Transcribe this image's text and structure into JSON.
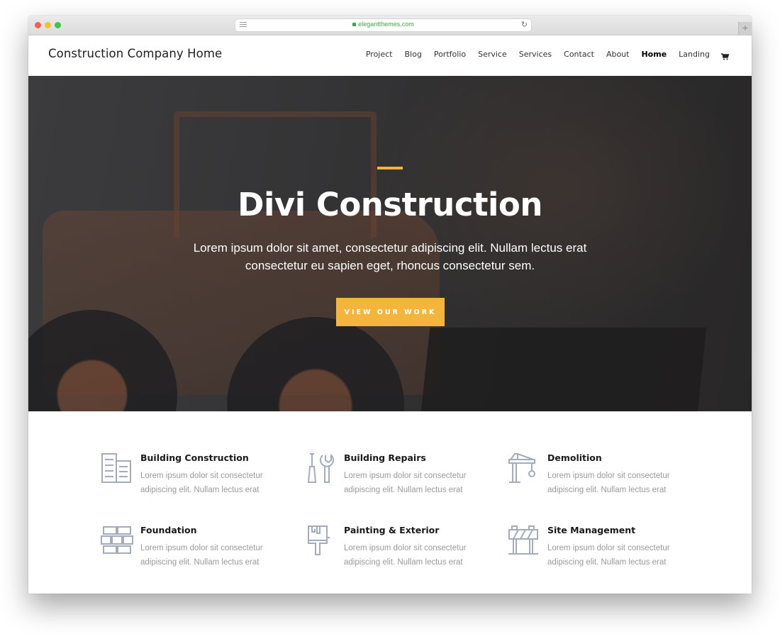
{
  "browser": {
    "url": "elegantthemes.com",
    "new_tab_label": "+",
    "reload_glyph": "↻"
  },
  "site": {
    "logo": "Construction Company Home",
    "nav": [
      {
        "label": "Project",
        "active": false
      },
      {
        "label": "Blog",
        "active": false
      },
      {
        "label": "Portfolio",
        "active": false
      },
      {
        "label": "Service",
        "active": false
      },
      {
        "label": "Services",
        "active": false
      },
      {
        "label": "Contact",
        "active": false
      },
      {
        "label": "About",
        "active": false
      },
      {
        "label": "Home",
        "active": true
      },
      {
        "label": "Landing",
        "active": false
      }
    ],
    "cart_icon": "shopping-cart-icon"
  },
  "hero": {
    "title": "Divi Construction",
    "subtitle": "Lorem ipsum dolor sit amet, consectetur adipiscing elit. Nullam lectus erat consectetur eu sapien eget, rhoncus consectetur sem.",
    "button_label": "VIEW OUR WORK",
    "accent_color": "#f3b53c"
  },
  "services": [
    {
      "title": "Building Construction",
      "desc": "Lorem ipsum dolor sit consectetur adipiscing elit. Nullam lectus erat",
      "icon": "buildings-icon"
    },
    {
      "title": "Building Repairs",
      "desc": "Lorem ipsum dolor sit consectetur adipiscing elit. Nullam lectus erat",
      "icon": "tools-icon"
    },
    {
      "title": "Demolition",
      "desc": "Lorem ipsum dolor sit consectetur adipiscing elit. Nullam lectus erat",
      "icon": "crane-icon"
    },
    {
      "title": "Foundation",
      "desc": "Lorem ipsum dolor sit consectetur adipiscing elit. Nullam lectus erat",
      "icon": "bricks-icon"
    },
    {
      "title": "Painting & Exterior",
      "desc": "Lorem ipsum dolor sit consectetur adipiscing elit. Nullam lectus erat",
      "icon": "paint-brush-icon"
    },
    {
      "title": "Site Management",
      "desc": "Lorem ipsum dolor sit consectetur adipiscing elit. Nullam lectus erat",
      "icon": "barrier-icon"
    }
  ]
}
